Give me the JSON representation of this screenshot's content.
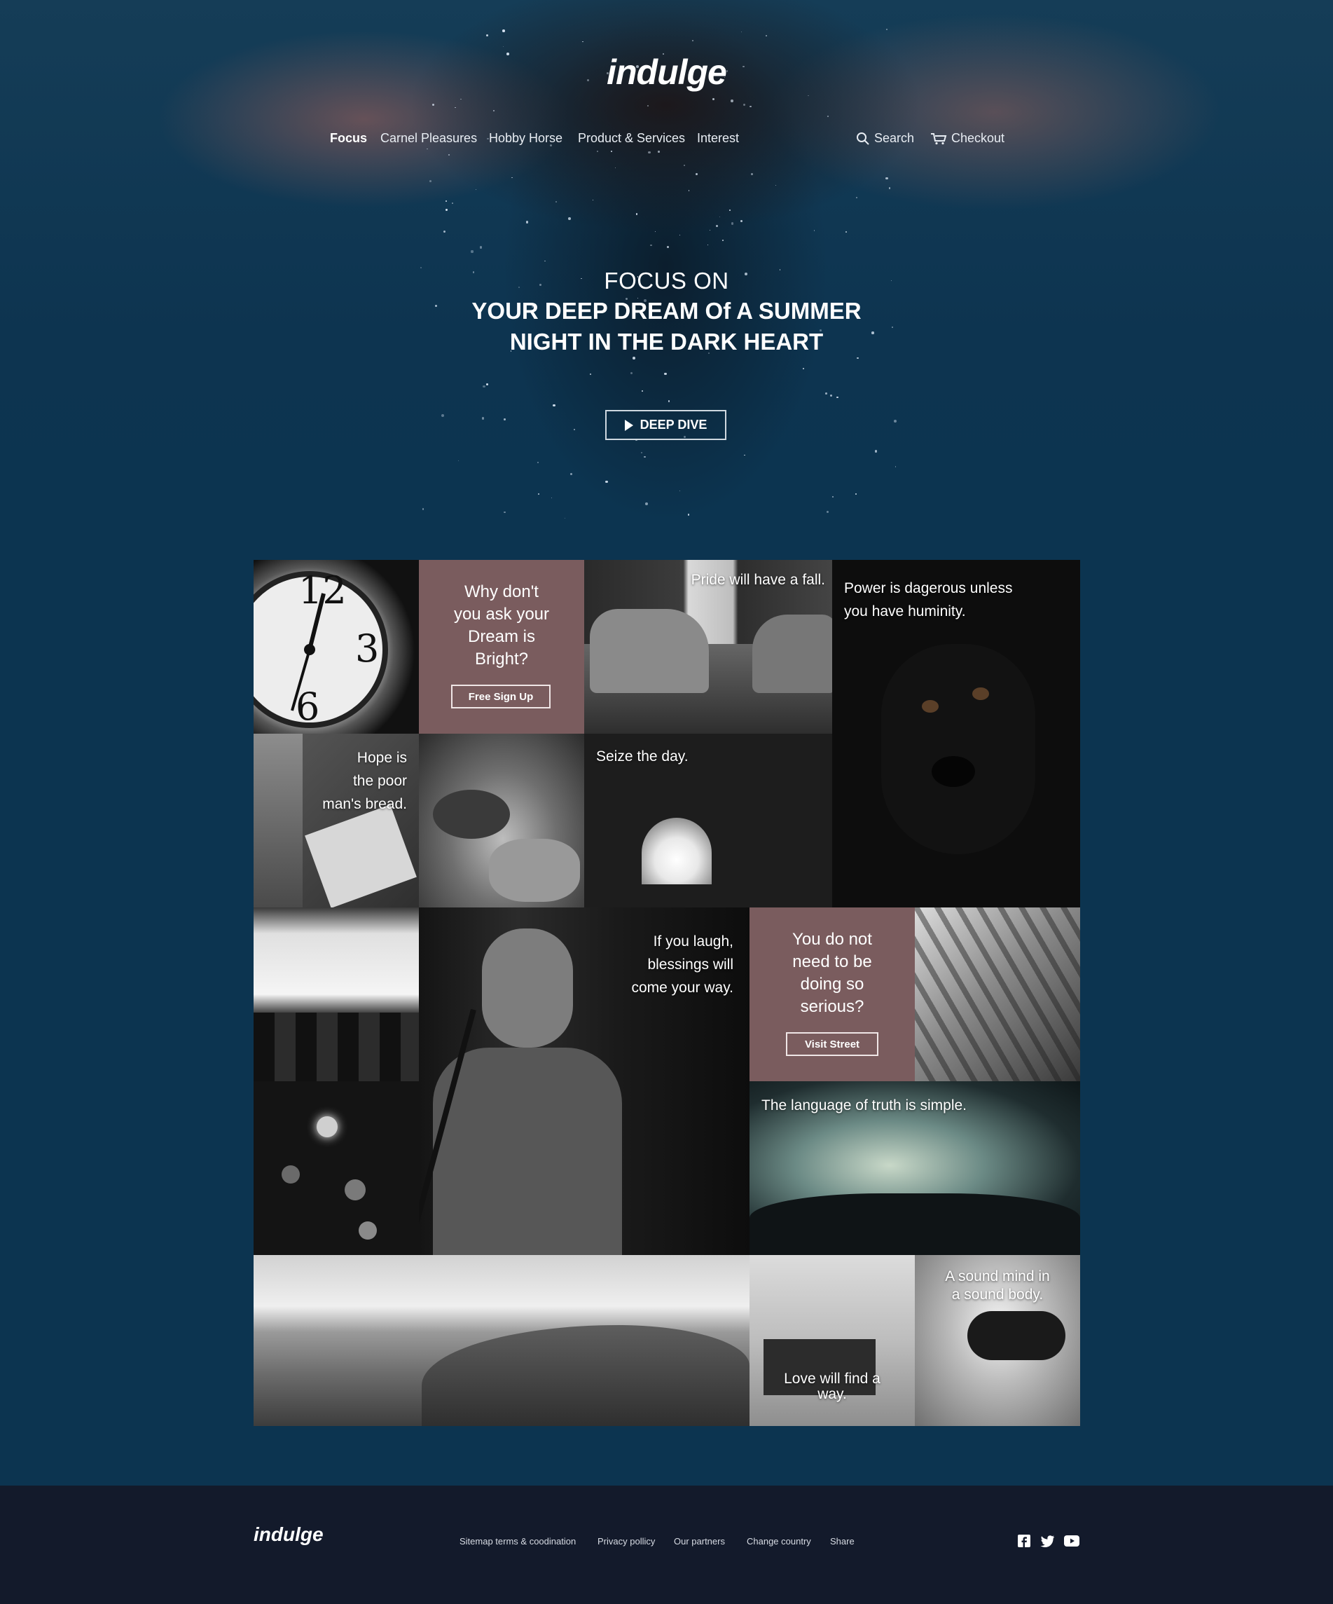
{
  "brand": {
    "logo": "indulge"
  },
  "nav": {
    "items": [
      {
        "label": "Focus",
        "active": true
      },
      {
        "label": "Carnel Pleasures",
        "active": false
      },
      {
        "label": "Hobby Horse",
        "active": false
      },
      {
        "label": "Product & Services",
        "active": false
      },
      {
        "label": "Interest",
        "active": false
      }
    ],
    "search_label": "Search",
    "checkout_label": "Checkout"
  },
  "hero": {
    "pre_title": "FOCUS ON",
    "title_line1": "YOUR DEEP DREAM Of A SUMMER",
    "title_line2": "NIGHT IN THE DARK HEART",
    "cta_label": "DEEP DIVE"
  },
  "tiles": {
    "clock": {
      "image": "clock"
    },
    "signup": {
      "line1": "Why don't",
      "line2": "you ask your",
      "line3": "Dream is",
      "line4": "Bright?",
      "button": "Free Sign Up"
    },
    "cars": {
      "caption": "Pride will have a fall."
    },
    "dog": {
      "line1": "Power is dagerous unless",
      "line2": "you have huminity."
    },
    "laptop": {
      "line1": "Hope is",
      "line2": "the poor",
      "line3": "man's bread."
    },
    "leaves": {
      "image": "leaves"
    },
    "tunnel": {
      "caption": "Seize the day."
    },
    "cafe": {
      "image": "cafe"
    },
    "singer": {
      "line1": "If you laugh,",
      "line2": "blessings will",
      "line3": "come your way."
    },
    "street": {
      "line1": "You do not",
      "line2": "need to be",
      "line3": "doing so",
      "line4": "serious?",
      "button": "Visit Street"
    },
    "crowd_station": {
      "image": "station"
    },
    "bokeh": {
      "image": "bokeh"
    },
    "concert": {
      "caption": "The language of truth is simple."
    },
    "field": {
      "image": "field"
    },
    "bench": {
      "line1": "Love will find a",
      "line2": "way."
    },
    "controller": {
      "line1": "A sound mind in",
      "line2": "a sound body."
    }
  },
  "footer": {
    "logo": "indulge",
    "links": [
      "Sitemap terms & coodination",
      "Privacy pollicy",
      "Our partners",
      "Change country",
      "Share"
    ],
    "social": [
      "facebook-icon",
      "twitter-icon",
      "youtube-icon"
    ]
  },
  "colors": {
    "background": "#0c3450",
    "accent_mauve": "#7a5c5e",
    "footer": "#131a2b"
  }
}
